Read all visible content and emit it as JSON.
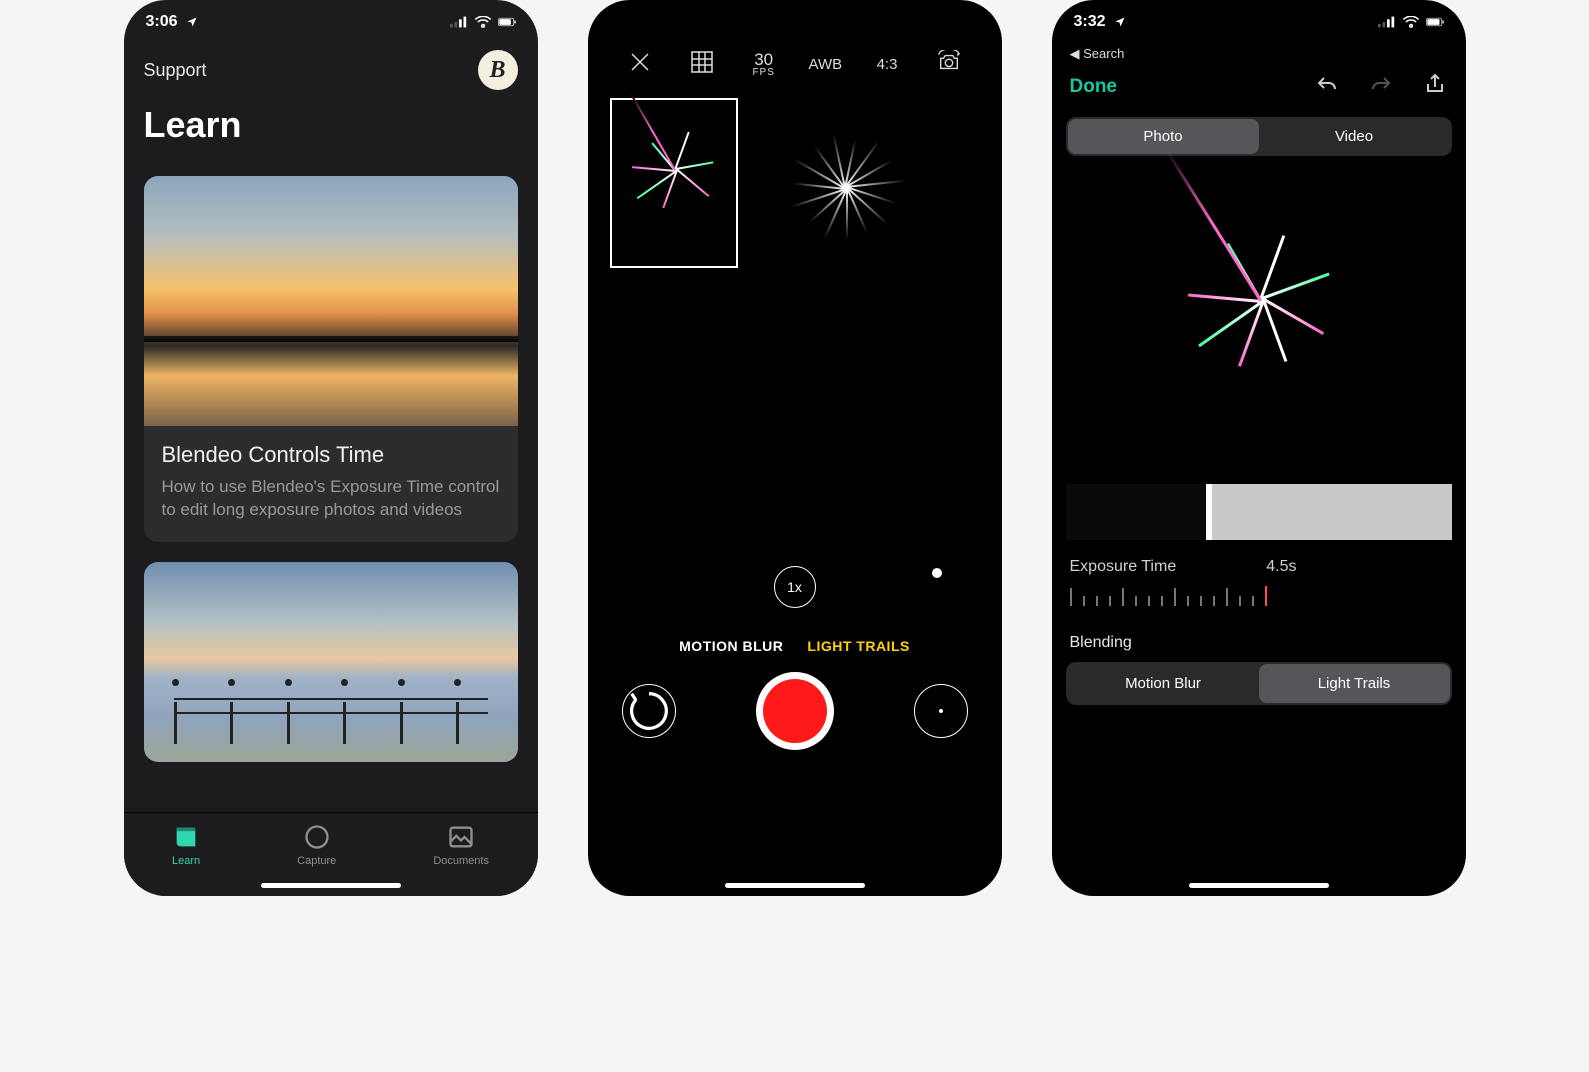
{
  "screen1": {
    "statusbar": {
      "time": "3:06"
    },
    "support_label": "Support",
    "avatar_letter": "B",
    "title": "Learn",
    "card1": {
      "title": "Blendeo Controls Time",
      "desc": "How to use Blendeo's Exposure Time control to edit long exposure photos and videos"
    },
    "tabs": {
      "learn": "Learn",
      "capture": "Capture",
      "documents": "Documents"
    }
  },
  "screen2": {
    "top": {
      "fps_num": "30",
      "fps_lbl": "FPS",
      "awb": "AWB",
      "ratio": "4:3"
    },
    "zoom": "1x",
    "modes": {
      "motion_blur": "MOTION BLUR",
      "light_trails": "LIGHT TRAILS"
    }
  },
  "screen3": {
    "statusbar": {
      "time": "3:32"
    },
    "back_search": "Search",
    "done": "Done",
    "seg": {
      "photo": "Photo",
      "video": "Video"
    },
    "exposure": {
      "label": "Exposure Time",
      "value": "4.5s"
    },
    "blending": {
      "label": "Blending",
      "motion_blur": "Motion Blur",
      "light_trails": "Light Trails"
    }
  }
}
